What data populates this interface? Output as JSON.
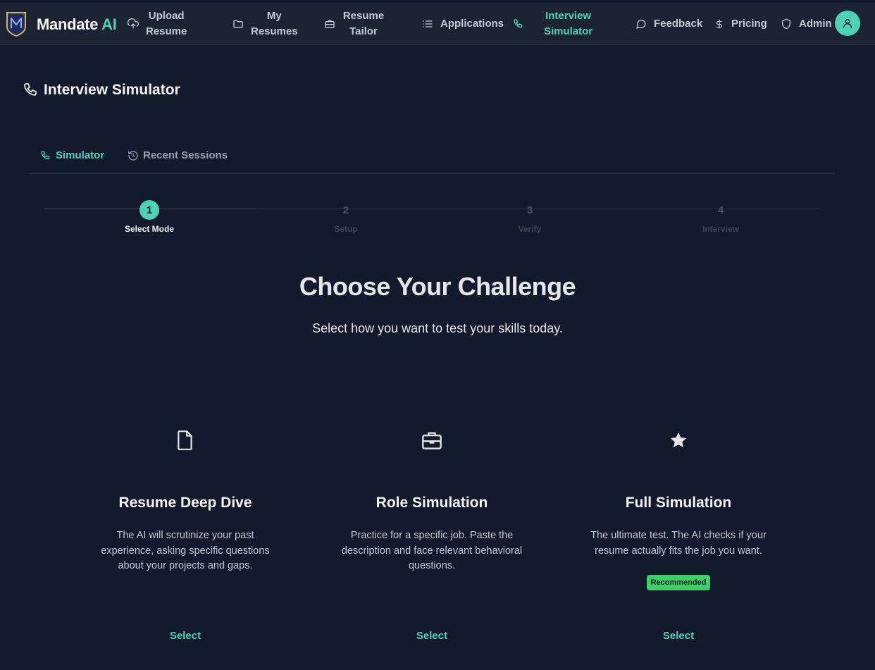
{
  "brand": {
    "name": "Mandate",
    "accent": "AI"
  },
  "nav": {
    "upload": [
      "Upload",
      "Resume"
    ],
    "my_resumes": [
      "My",
      "Resumes"
    ],
    "tailor": [
      "Resume",
      "Tailor"
    ],
    "applications": "Applications",
    "simulator": [
      "Interview",
      "Simulator"
    ],
    "feedback": "Feedback",
    "pricing": "Pricing",
    "admin": "Admin"
  },
  "page_title": "Interview Simulator",
  "tabs": [
    {
      "label": "Simulator",
      "active": true
    },
    {
      "label": "Recent Sessions",
      "active": false
    }
  ],
  "steps": [
    {
      "num": "1",
      "label": "Select Mode",
      "active": true
    },
    {
      "num": "2",
      "label": "Setup",
      "active": false
    },
    {
      "num": "3",
      "label": "Verify",
      "active": false
    },
    {
      "num": "4",
      "label": "Interview",
      "active": false
    }
  ],
  "heading": "Choose Your Challenge",
  "subheading": "Select how you want to test your skills today.",
  "cards": [
    {
      "icon": "file-icon",
      "title": "Resume Deep Dive",
      "desc": "The AI will scrutinize your past experience, asking specific questions about your projects and gaps.",
      "badge": "",
      "action": "Select"
    },
    {
      "icon": "briefcase-icon",
      "title": "Role Simulation",
      "desc": "Practice for a specific job. Paste the description and face relevant behavioral questions.",
      "badge": "",
      "action": "Select"
    },
    {
      "icon": "star-icon",
      "title": "Full Simulation",
      "desc": "The ultimate test. The AI checks if your resume actually fits the job you want.",
      "badge": "Recommended",
      "action": "Select"
    }
  ],
  "colors": {
    "accent": "#4fd1b5",
    "background": "#121a2b",
    "topbar": "#1c2433",
    "badge": "#3ecf6a"
  }
}
